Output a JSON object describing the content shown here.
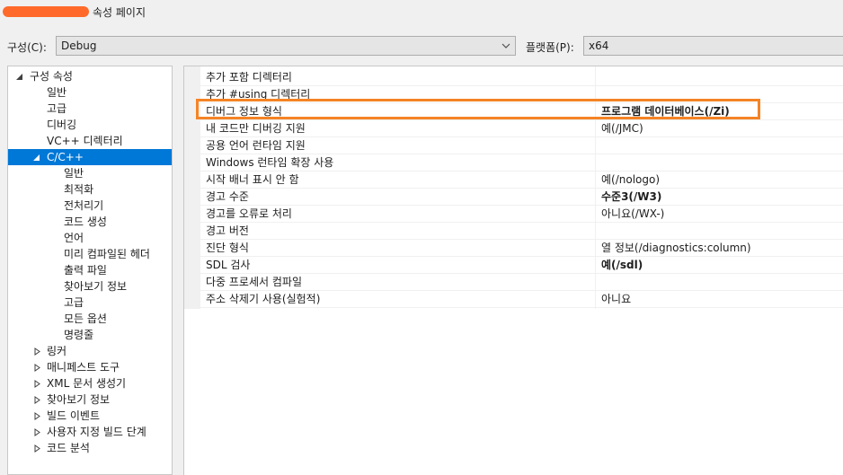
{
  "window": {
    "title": "속성 페이지"
  },
  "toolbar": {
    "config_label": "구성(C):",
    "config_value": "Debug",
    "platform_label": "플랫폼(P):",
    "platform_value": "x64"
  },
  "tree": {
    "items": [
      {
        "label": "구성 속성"
      },
      {
        "label": "일반"
      },
      {
        "label": "고급"
      },
      {
        "label": "디버깅"
      },
      {
        "label": "VC++ 디렉터리"
      },
      {
        "label": "C/C++"
      },
      {
        "label": "일반"
      },
      {
        "label": "최적화"
      },
      {
        "label": "전처리기"
      },
      {
        "label": "코드 생성"
      },
      {
        "label": "언어"
      },
      {
        "label": "미리 컴파일된 헤더"
      },
      {
        "label": "출력 파일"
      },
      {
        "label": "찾아보기 정보"
      },
      {
        "label": "고급"
      },
      {
        "label": "모든 옵션"
      },
      {
        "label": "명령줄"
      },
      {
        "label": "링커"
      },
      {
        "label": "매니페스트 도구"
      },
      {
        "label": "XML 문서 생성기"
      },
      {
        "label": "찾아보기 정보"
      },
      {
        "label": "빌드 이벤트"
      },
      {
        "label": "사용자 지정 빌드 단계"
      },
      {
        "label": "코드 분석"
      }
    ]
  },
  "properties": [
    {
      "name": "추가 포함 디렉터리",
      "value": ""
    },
    {
      "name": "추가 #using 디렉터리",
      "value": ""
    },
    {
      "name": "디버그 정보 형식",
      "value": "프로그램 데이터베이스(/Zi)"
    },
    {
      "name": "내 코드만 디버깅 지원",
      "value": "예(/JMC)"
    },
    {
      "name": "공용 언어 런타임 지원",
      "value": ""
    },
    {
      "name": "Windows 런타임 확장 사용",
      "value": ""
    },
    {
      "name": "시작 배너 표시 안 함",
      "value": "예(/nologo)"
    },
    {
      "name": "경고 수준",
      "value": "수준3(/W3)"
    },
    {
      "name": "경고를 오류로 처리",
      "value": "아니요(/WX-)"
    },
    {
      "name": "경고 버전",
      "value": ""
    },
    {
      "name": "진단 형식",
      "value": "열 정보(/diagnostics:column)"
    },
    {
      "name": "SDL 검사",
      "value": "예(/sdl)"
    },
    {
      "name": "다중 프로세서 컴파일",
      "value": ""
    },
    {
      "name": "주소 삭제기 사용(실험적)",
      "value": "아니요"
    }
  ],
  "colors": {
    "accent": "#0078d7",
    "highlight": "#f58426"
  }
}
